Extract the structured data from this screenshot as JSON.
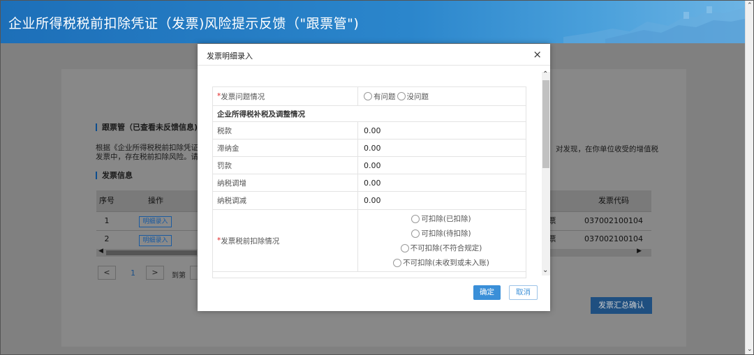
{
  "header": {
    "title": "企业所得税税前扣除凭证（发票)风险提示反馈（\"跟票管\")"
  },
  "page": {
    "section1_title": "跟票管（已查看未反馈信息)",
    "para_left_line1": "根据《企业所得税税前扣除凭证",
    "para_left_line2": "发票中，存在税前扣除风险。请",
    "para_right": "对发现，在你单位收受的增值税",
    "section2_title": "发票信息",
    "table": {
      "headers": {
        "seq": "序号",
        "op": "操作",
        "code": "发票代码"
      },
      "rows": [
        {
          "seq": "1",
          "btn": "明细录入",
          "code": "037002100104"
        },
        {
          "seq": "2",
          "btn": "明细录入",
          "code": "037002100104"
        }
      ]
    },
    "pager": {
      "prev": "<",
      "page": "1",
      "next": ">",
      "goto": "到第"
    },
    "summary_button": "发票汇总确认"
  },
  "modal": {
    "title": "发票明细录入",
    "close": "×",
    "rows": {
      "issue_label": "发票问题情况",
      "issue_opt1": "有问题",
      "issue_opt2": "没问题",
      "subheader": "企业所得税补税及调整情况",
      "tax_label": "税款",
      "tax_value": "0.00",
      "late_label": "滞纳金",
      "late_value": "0.00",
      "fine_label": "罚款",
      "fine_value": "0.00",
      "inc_label": "纳税调增",
      "inc_value": "0.00",
      "dec_label": "纳税调减",
      "dec_value": "0.00",
      "deduct_label": "发票税前扣除情况",
      "deduct_opt1": "可扣除(已扣除)",
      "deduct_opt2": "可扣除(待扣除)",
      "deduct_opt3": "不可扣除(不符合规定)",
      "deduct_opt4": "不可扣除(未收到或未入账)"
    },
    "ok": "确定",
    "cancel": "取消"
  }
}
